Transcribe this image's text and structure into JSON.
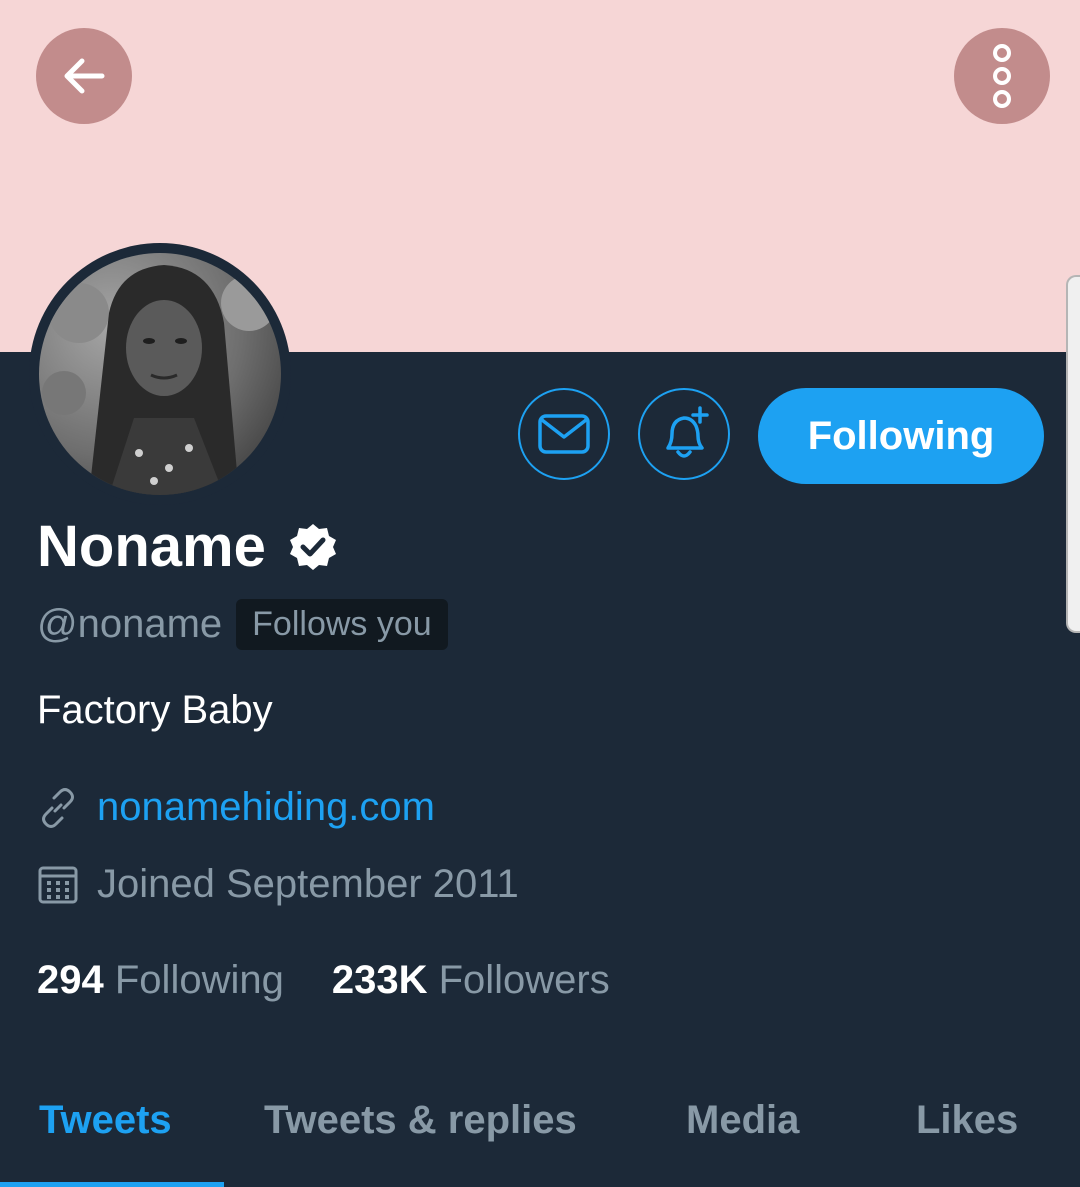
{
  "profile": {
    "display_name": "Noname",
    "handle": "@noname",
    "follows_you": "Follows you",
    "bio": "Factory Baby",
    "website": "nonamehiding.com",
    "joined": "Joined September 2011",
    "verified": true
  },
  "actions": {
    "following_label": "Following"
  },
  "stats": {
    "following_count": "294",
    "following_label": "Following",
    "followers_count": "233K",
    "followers_label": "Followers"
  },
  "tabs": [
    {
      "label": "Tweets",
      "active": true
    },
    {
      "label": "Tweets & replies",
      "active": false
    },
    {
      "label": "Media",
      "active": false
    },
    {
      "label": "Likes",
      "active": false
    }
  ],
  "colors": {
    "accent": "#1da1f2",
    "background": "#1c2938",
    "banner": "#f6d6d6",
    "muted_text": "#8899a6"
  },
  "icons": {
    "back": "arrow-left-icon",
    "more": "more-vertical-icon",
    "message": "envelope-icon",
    "notifications": "bell-plus-icon",
    "verified": "verified-badge-icon",
    "link": "link-icon",
    "calendar": "calendar-icon"
  }
}
